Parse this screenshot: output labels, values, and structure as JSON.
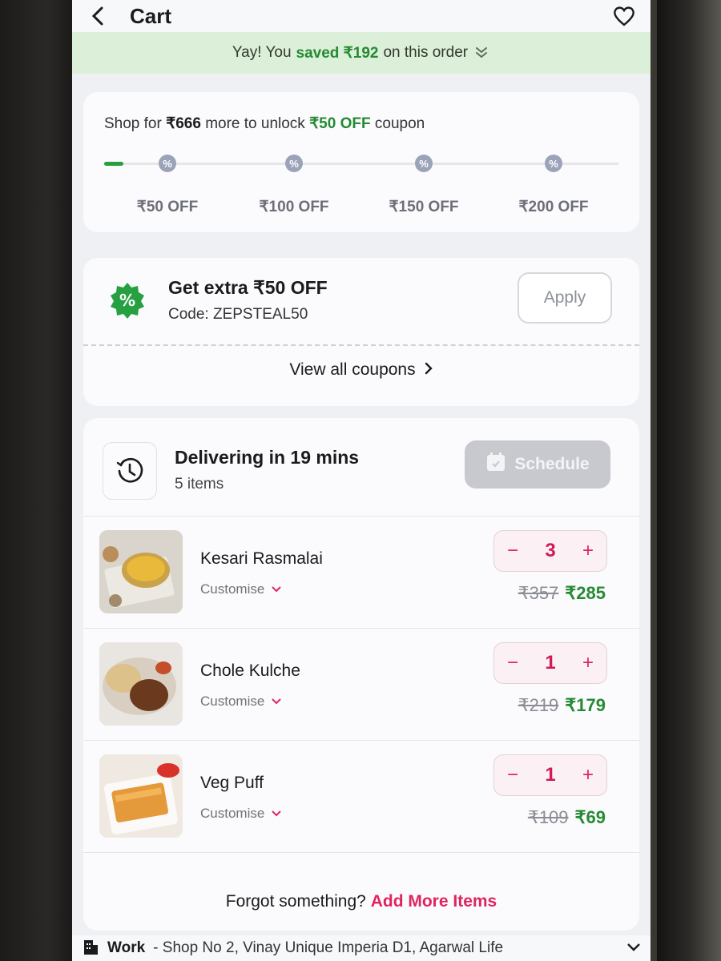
{
  "header": {
    "title": "Cart"
  },
  "savings_banner": {
    "prefix": "Yay! You",
    "saved": "saved ₹192",
    "suffix": "on this order"
  },
  "coupon_progress": {
    "prefix": "Shop for",
    "amount": "₹666",
    "middle": "more to unlock",
    "reward": "₹50 OFF",
    "suffix": "coupon",
    "tiers": [
      "₹50 OFF",
      "₹100 OFF",
      "₹150 OFF",
      "₹200 OFF"
    ]
  },
  "coupon": {
    "title": "Get extra ₹50 OFF",
    "code": "Code: ZEPSTEAL50",
    "apply_label": "Apply",
    "view_all": "View all coupons"
  },
  "delivery": {
    "title": "Delivering in 19 mins",
    "items_count": "5 items",
    "schedule_label": "Schedule"
  },
  "items": [
    {
      "name": "Kesari Rasmalai",
      "customise": "Customise",
      "qty": "3",
      "mrp": "₹357",
      "price": "₹285"
    },
    {
      "name": "Chole Kulche",
      "customise": "Customise",
      "qty": "1",
      "mrp": "₹219",
      "price": "₹179"
    },
    {
      "name": "Veg Puff",
      "customise": "Customise",
      "qty": "1",
      "mrp": "₹109",
      "price": "₹69"
    }
  ],
  "forgot": {
    "question": "Forgot something?",
    "action": "Add More Items"
  },
  "address": {
    "label": "Work",
    "text": "- Shop No 2, Vinay Unique Imperia D1, Agarwal Life"
  },
  "colors": {
    "accent_green": "#258a33",
    "accent_pink": "#e0245e",
    "banner_green": "#dcefd8"
  }
}
